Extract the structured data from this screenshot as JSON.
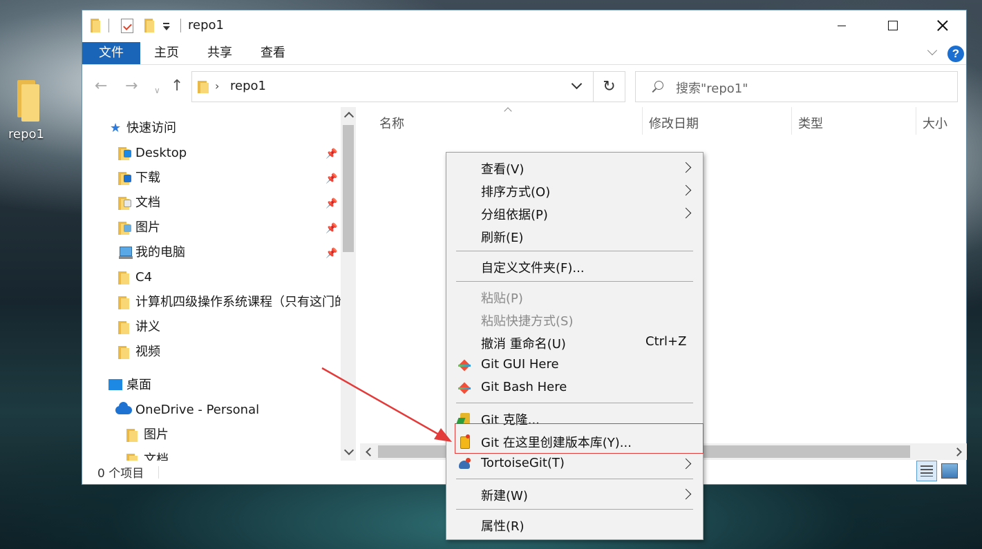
{
  "desktop": {
    "icon_label": "repo1"
  },
  "window": {
    "title": "repo1",
    "controls": {
      "minimize": "minimize",
      "maximize": "maximize",
      "close": "close"
    }
  },
  "ribbon": {
    "tabs": [
      "文件",
      "主页",
      "共享",
      "查看"
    ],
    "help": "?"
  },
  "address_bar": {
    "path": "repo1",
    "search_placeholder": "搜索\"repo1\""
  },
  "nav_pane": {
    "quick_access": "快速访问",
    "pinned": [
      {
        "label": "Desktop",
        "icon": "desktop-folder-icon"
      },
      {
        "label": "下载",
        "icon": "downloads-folder-icon"
      },
      {
        "label": "文档",
        "icon": "documents-folder-icon"
      },
      {
        "label": "图片",
        "icon": "pictures-folder-icon"
      },
      {
        "label": "我的电脑",
        "icon": "this-pc-icon"
      }
    ],
    "folders": [
      "C4",
      "计算机四级操作系统课程（只有这门的",
      "讲义",
      "视频"
    ],
    "desktop": "桌面",
    "onedrive": "OneDrive - Personal",
    "onedrive_children": [
      "图片",
      "文档"
    ]
  },
  "file_list": {
    "columns": [
      "名称",
      "修改日期",
      "类型",
      "大小"
    ]
  },
  "status_bar": {
    "item_count": "0 个项目"
  },
  "context_menu": {
    "items": [
      {
        "label": "查看(V)",
        "submenu": true
      },
      {
        "label": "排序方式(O)",
        "submenu": true
      },
      {
        "label": "分组依据(P)",
        "submenu": true
      },
      {
        "label": "刷新(E)"
      },
      {
        "label": "自定义文件夹(F)..."
      },
      {
        "label": "粘贴(P)",
        "disabled": true
      },
      {
        "label": "粘贴快捷方式(S)",
        "disabled": true
      },
      {
        "label": "撤消 重命名(U)",
        "shortcut": "Ctrl+Z"
      },
      {
        "label": "Git GUI Here",
        "icon": "git-gui-icon"
      },
      {
        "label": "Git Bash Here",
        "icon": "git-bash-icon"
      },
      {
        "label": "Git 克隆...",
        "icon": "git-clone-icon"
      },
      {
        "label": "Git 在这里创建版本库(Y)...",
        "icon": "git-create-repo-icon"
      },
      {
        "label": "TortoiseGit(T)",
        "icon": "tortoisegit-icon",
        "submenu": true
      },
      {
        "label": "新建(W)",
        "submenu": true
      },
      {
        "label": "属性(R)"
      }
    ]
  },
  "colors": {
    "accent": "#1b65b8",
    "annotation_red": "#e33a3a",
    "folder_yellow": "#f8d774"
  }
}
